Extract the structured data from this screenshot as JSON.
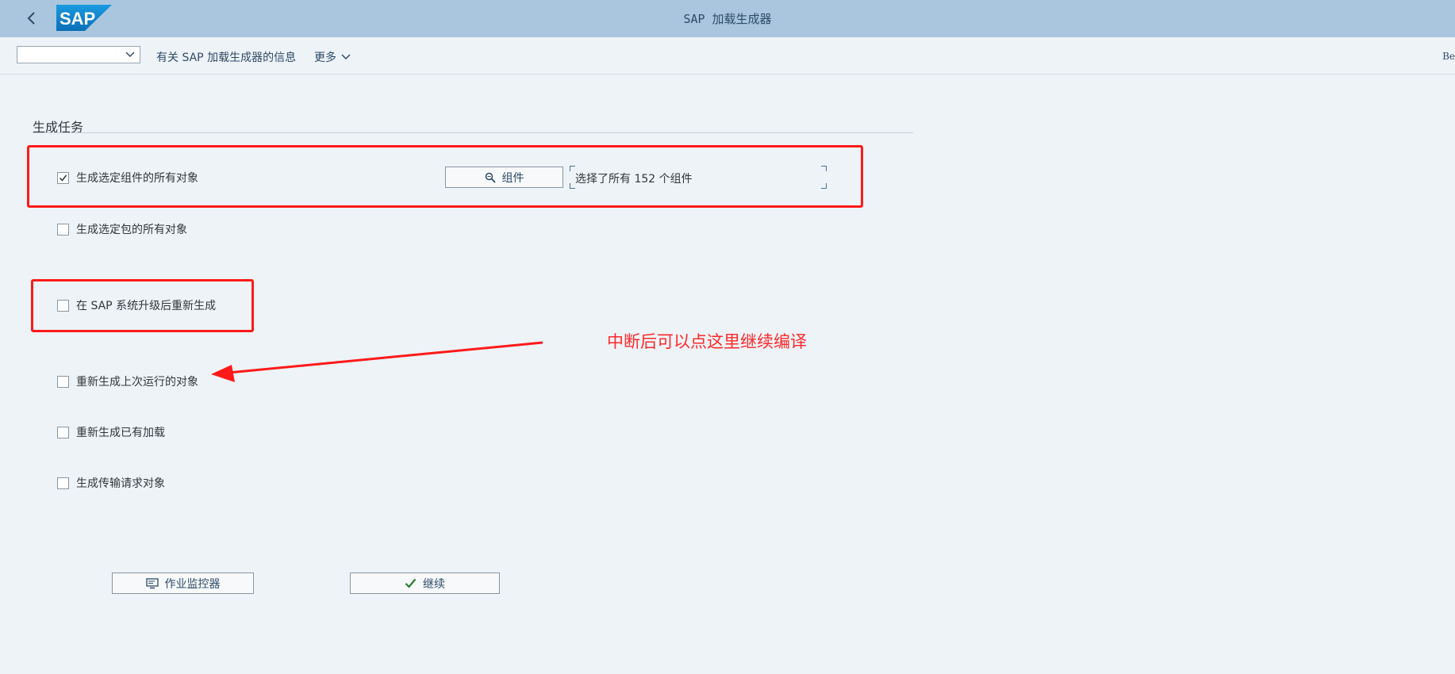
{
  "shell": {
    "title": "SAP 加载生成器",
    "logo_text": "SAP"
  },
  "toolbar": {
    "select_value": "",
    "info_link": "有关 SAP 加载生成器的信息",
    "more_label": "更多",
    "right_truncated": "Be"
  },
  "section": {
    "title": "生成任务"
  },
  "options": [
    {
      "label": "生成选定组件的所有对象",
      "checked": true
    },
    {
      "label": "生成选定包的所有对象",
      "checked": false
    },
    {
      "label": "在 SAP 系统升级后重新生成",
      "checked": false
    },
    {
      "label": "重新生成上次运行的对象",
      "checked": false
    },
    {
      "label": "重新生成已有加载",
      "checked": false
    },
    {
      "label": "生成传输请求对象",
      "checked": false
    }
  ],
  "components_button": {
    "label": "组件"
  },
  "components_status": "选择了所有 152  个组件",
  "buttons": {
    "job_monitor": "作业监控器",
    "continue": "继续"
  },
  "annotation": {
    "text": "中断后可以点这里继续编译",
    "color": "#ff2a2a"
  },
  "colors": {
    "shell_bg": "#a9c6de",
    "page_bg": "#eef3f8",
    "highlight": "#ff1a1a",
    "check_green": "#2b7d2b"
  }
}
